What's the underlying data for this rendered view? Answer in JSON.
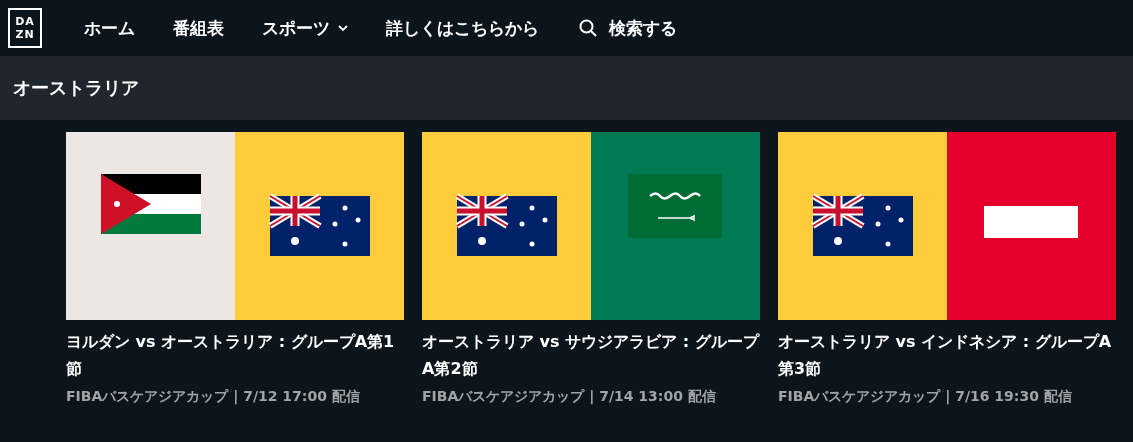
{
  "logo": {
    "lines": [
      "DA",
      "ZN"
    ]
  },
  "nav": [
    {
      "label": "ホーム",
      "kind": "link"
    },
    {
      "label": "番組表",
      "kind": "link"
    },
    {
      "label": "スポーツ",
      "kind": "dropdown"
    },
    {
      "label": "詳しくはこちらから",
      "kind": "link"
    },
    {
      "label": "検索する",
      "kind": "search"
    }
  ],
  "section": {
    "title": "オーストラリア"
  },
  "cards": [
    {
      "kind": "picture",
      "title": "ヨルダン vs オーストラリア : グループA第1節",
      "meta": "FIBAバスケアジアカップ | 7/12 17:00 配信"
    },
    {
      "kind": "picture",
      "title": "オーストラリア vs サウジアラビア : グループA第2節",
      "meta": "FIBAバスケアジアカップ | 7/14 13:00 配信"
    },
    {
      "kind": "picture",
      "title": "オーストラリア vs インドネシア : グループA第3節",
      "meta": "FIBAバスケアジアカップ | 7/16 19:30 配信"
    }
  ]
}
